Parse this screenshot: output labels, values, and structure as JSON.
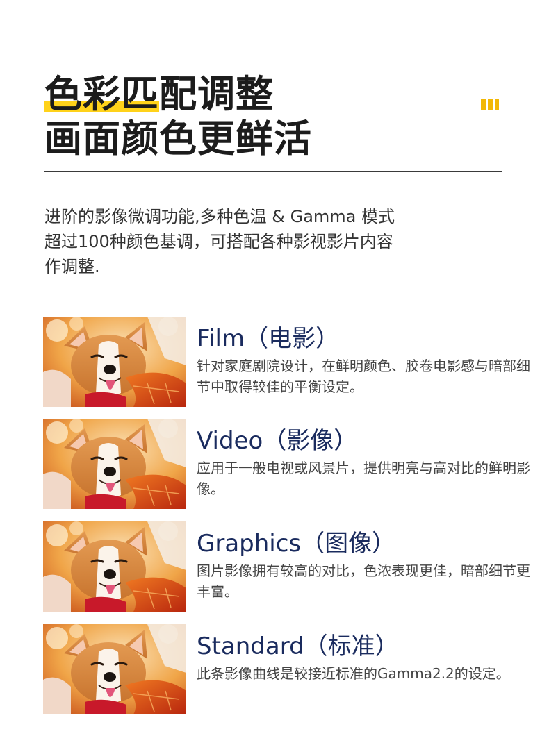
{
  "headline": {
    "line1_highlight": "色彩匹",
    "line1_rest": "配调整",
    "line2": "画面颜色更鲜活"
  },
  "intro": {
    "lines": [
      "进阶的影像微调功能,多种色温 & Gamma 模式",
      "超过100种颜色基调，可搭配各种影视影片内容",
      "作调整."
    ]
  },
  "modes": [
    {
      "title": "Film（电影）",
      "desc": "针对家庭剧院设计，在鲜明颜色、胶卷电影感与暗部细节中取得较佳的平衡设定。",
      "image": "corgi-photo"
    },
    {
      "title": "Video（影像）",
      "desc": "应用于一般电视或风景片，提供明亮与高对比的鲜明影像。",
      "image": "corgi-photo"
    },
    {
      "title": "Graphics（图像）",
      "desc": "图片影像拥有较高的对比，色浓表现更佳，暗部细节更丰富。",
      "image": "corgi-photo"
    },
    {
      "title": "Standard（标准）",
      "desc": "此条影像曲线是较接近标准的Gamma2.2的设定。",
      "image": "corgi-photo"
    }
  ],
  "colors": {
    "highlight": "#ffd21a",
    "deco": "#f2b705",
    "mode_title": "#1a2b5e"
  }
}
